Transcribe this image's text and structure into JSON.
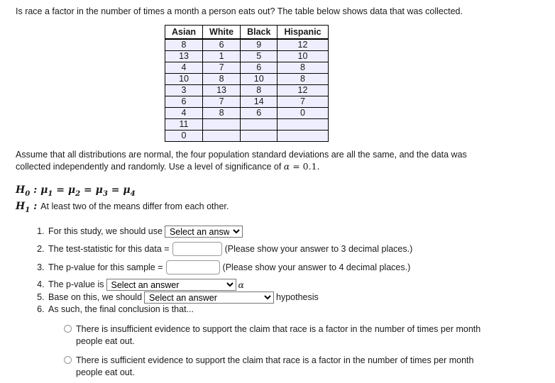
{
  "intro": "Is race a factor in the number of times a month a person eats out? The table below shows data that was collected.",
  "table": {
    "headers": [
      "Asian",
      "White",
      "Black",
      "Hispanic"
    ],
    "rows": [
      [
        "8",
        "6",
        "9",
        "12"
      ],
      [
        "13",
        "1",
        "5",
        "10"
      ],
      [
        "4",
        "7",
        "6",
        "8"
      ],
      [
        "10",
        "8",
        "10",
        "8"
      ],
      [
        "3",
        "13",
        "8",
        "12"
      ],
      [
        "6",
        "7",
        "14",
        "7"
      ],
      [
        "4",
        "8",
        "6",
        "0"
      ],
      [
        "11",
        "",
        "",
        ""
      ],
      [
        "0",
        "",
        "",
        ""
      ]
    ]
  },
  "assumption": {
    "part1": "Assume that all distributions are normal, the four population standard deviations are all the same, and the data was collected independently and randomly. Use a level of significance of ",
    "alpha": "α",
    "equals": " = 0.1."
  },
  "hypotheses": {
    "h0_symbol": "H",
    "h0_sub": "0",
    "h0_colon": " : ",
    "h0_body": "μ1 = μ2 = μ3 = μ4",
    "h1_symbol": "H",
    "h1_sub": "1",
    "h1_colon": " : ",
    "h1_text": "At least two of the means differ from each other."
  },
  "questions": {
    "q1": {
      "label": "For this study, we should use",
      "select_value": "Select an answer"
    },
    "q2": {
      "label": "The test-statistic for this data =",
      "input_value": "",
      "hint": "(Please show your answer to 3 decimal places.)"
    },
    "q3": {
      "label": "The p-value for this sample =",
      "input_value": "",
      "hint": "(Please show your answer to 4 decimal places.)"
    },
    "q4": {
      "label": "The p-value is",
      "select_value": "Select an answer",
      "suffix": "α"
    },
    "q5": {
      "label": "Base on this, we should",
      "select_value": "Select an answer",
      "suffix": "hypothesis"
    },
    "q6": {
      "label": "As such, the final conclusion is that..."
    }
  },
  "choices": [
    {
      "text": "There is insufficient evidence to support the claim that race is a factor in the number of times per month people eat out.",
      "selected": false
    },
    {
      "text": "There is sufficient evidence to support the claim that race is a factor in the number of times per month people eat out.",
      "selected": false
    }
  ],
  "colors": {
    "table_cell_bg": "#eeeeff",
    "table_border": "#000000",
    "page_bg": "#ffffff"
  }
}
